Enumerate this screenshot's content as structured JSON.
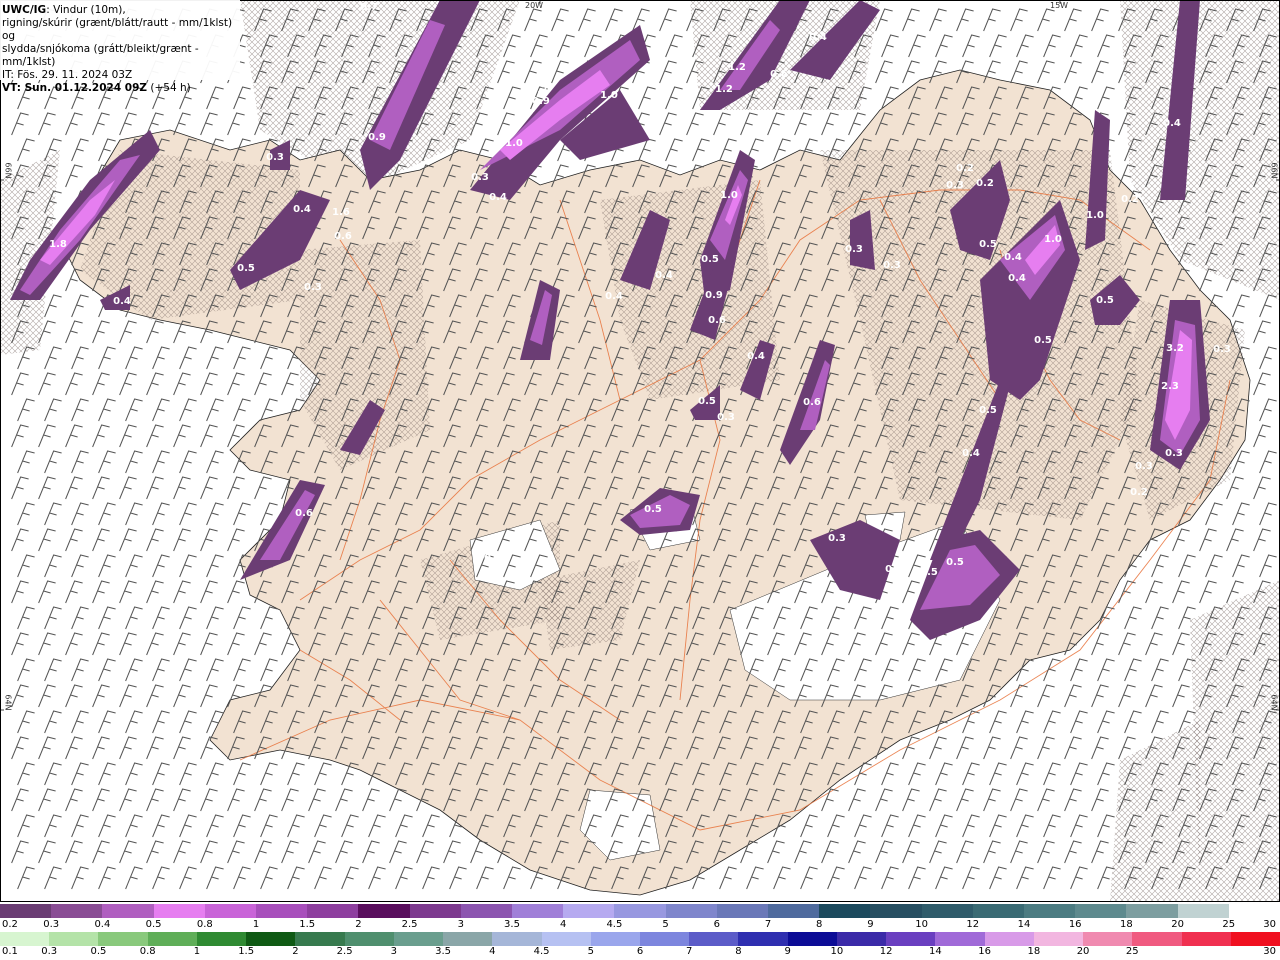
{
  "header": {
    "model": "UWC/IG",
    "line1_rest": ": Vindur (10m),",
    "line2": "rigning/skúrir (grænt/blátt/rautt - mm/1klst) og",
    "line3": "slydda/snjókoma (grátt/bleikt/grænt - mm/1klst)",
    "init_time": "IT: Fös. 29. 11. 2024 03Z",
    "valid_label": "VT: Sun. 01.12.2024 09Z",
    "lead": "(+54 h)"
  },
  "axis_labels": {
    "top_20w": "20W",
    "top_15w": "15W",
    "left_66n": "66N",
    "right_66n": "66N",
    "left_64n": "64N",
    "right_64n": "64N"
  },
  "precip_labels": [
    {
      "v": "1.8"
    },
    {
      "v": "0.4"
    },
    {
      "v": "0.5"
    },
    {
      "v": "0.4"
    },
    {
      "v": "1.6"
    },
    {
      "v": "0.6"
    },
    {
      "v": "0.3"
    },
    {
      "v": "0.9"
    },
    {
      "v": "0.3"
    },
    {
      "v": "0.7"
    },
    {
      "v": "1.0"
    },
    {
      "v": "0.3"
    },
    {
      "v": "0.4"
    },
    {
      "v": "1.0"
    },
    {
      "v": "1.2"
    },
    {
      "v": "0.6"
    },
    {
      "v": "1.2"
    },
    {
      "v": "0.4"
    },
    {
      "v": "0.9"
    },
    {
      "v": "0.7"
    },
    {
      "v": "0.4"
    },
    {
      "v": "0.4"
    },
    {
      "v": "1.0"
    },
    {
      "v": "0.5"
    },
    {
      "v": "0.9"
    },
    {
      "v": "0.6"
    },
    {
      "v": "0.4"
    },
    {
      "v": "0.5"
    },
    {
      "v": "0.3"
    },
    {
      "v": "0.6"
    },
    {
      "v": "0.5"
    },
    {
      "v": "0.6"
    },
    {
      "v": "0.3"
    },
    {
      "v": "0.3"
    },
    {
      "v": "0.3"
    },
    {
      "v": "0.2"
    },
    {
      "v": "0.3"
    },
    {
      "v": "0.2"
    },
    {
      "v": "0.5"
    },
    {
      "v": "0.4"
    },
    {
      "v": "1.0"
    },
    {
      "v": "0.4"
    },
    {
      "v": "1.0"
    },
    {
      "v": "0.5"
    },
    {
      "v": "0.5"
    },
    {
      "v": "3.2"
    },
    {
      "v": "2.3"
    },
    {
      "v": "0.5"
    },
    {
      "v": "0.4"
    },
    {
      "v": "0.3"
    },
    {
      "v": "0.3"
    },
    {
      "v": "0.2"
    },
    {
      "v": "0.3"
    },
    {
      "v": "0.5"
    },
    {
      "v": "0.5"
    },
    {
      "v": "0.5"
    },
    {
      "v": "0.3"
    },
    {
      "v": "0.2"
    },
    {
      "v": "0.4"
    }
  ],
  "legend": {
    "snow_colors": [
      "#6b3d74",
      "#8a4d95",
      "#b05fc0",
      "#e67ef0",
      "#c964d8",
      "#a84fbc",
      "#8e3f9f",
      "#5a0f5e",
      "#7d3a8f",
      "#8c55b0",
      "#a07fd8",
      "#b6aaf0",
      "#9898e0",
      "#7f86cc",
      "#6a78b8",
      "#4f6b9e",
      "#1c4a5e",
      "#274f62",
      "#2f5c6b",
      "#3a6b74",
      "#4c7c82",
      "#5e8a8e",
      "#7d9ea0",
      "#c0d2d2"
    ],
    "snow_labels": [
      "0.2",
      "0.3",
      "0.4",
      "0.5",
      "0.8",
      "1",
      "1.5",
      "2",
      "2.5",
      "3",
      "3.5",
      "4",
      "4.5",
      "5",
      "6",
      "7",
      "8",
      "9",
      "10",
      "12",
      "14",
      "16",
      "18",
      "20",
      "25",
      "30"
    ],
    "rain_colors": [
      "#d7f5d0",
      "#b4e3a8",
      "#89c97c",
      "#5fae58",
      "#2f8a32",
      "#0f5a14",
      "#377a4e",
      "#4f8f6e",
      "#6a9e8e",
      "#8aa6a8",
      "#a5b6d8",
      "#b6c1f2",
      "#9aa6ec",
      "#7d86de",
      "#5c5cc8",
      "#2f2fb0",
      "#0c0c96",
      "#3b2aa8",
      "#6a3fc0",
      "#a06ad8",
      "#d89ae8",
      "#f2b6e0",
      "#f08ab0",
      "#f05a80",
      "#f03050",
      "#f01020"
    ],
    "rain_labels": [
      "0.1",
      "0.3",
      "0.5",
      "0.8",
      "1",
      "1.5",
      "2",
      "2.5",
      "3",
      "3.5",
      "4",
      "4.5",
      "5",
      "6",
      "7",
      "8",
      "9",
      "10",
      "12",
      "14",
      "16",
      "18",
      "20",
      "25",
      "30"
    ]
  },
  "colors": {
    "land": "#f2e2d2",
    "coast": "#222222",
    "roads": "#e8723a",
    "hatch": "#6f5f5a",
    "wind": "#555555"
  }
}
